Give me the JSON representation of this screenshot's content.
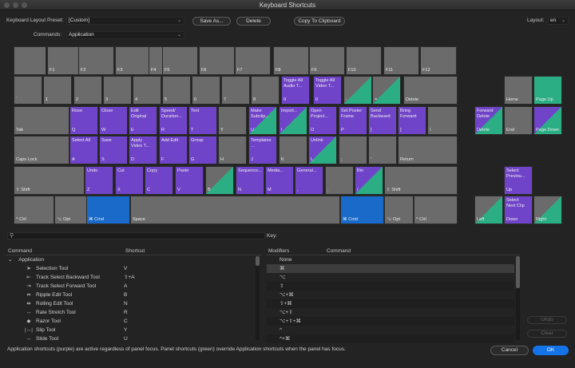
{
  "window": {
    "title": "Keyboard Shortcuts"
  },
  "toolbar": {
    "preset_label": "Keyboard Layout Preset:",
    "preset_value": "[Custom]",
    "commands_label": "Commands:",
    "commands_value": "Application",
    "save_as": "Save As...",
    "delete": "Delete",
    "copy": "Copy To Clipboard",
    "layout_label": "Layout:",
    "layout_value": "en"
  },
  "colors": {
    "application": "#7044c8",
    "panel": "#2cae85",
    "modifier": "#1a6bc9"
  },
  "keyboard": {
    "keys": [
      {
        "label": "",
        "cmd": ""
      },
      {
        "label": "F1",
        "cmd": ""
      },
      {
        "label": "F2",
        "cmd": ""
      },
      {
        "label": "F3",
        "cmd": ""
      },
      {
        "label": "F4",
        "cmd": ""
      },
      {
        "label": "F5",
        "cmd": ""
      },
      {
        "label": "F6",
        "cmd": ""
      },
      {
        "label": "F7",
        "cmd": ""
      },
      {
        "label": "F8",
        "cmd": ""
      },
      {
        "label": "F9",
        "cmd": ""
      },
      {
        "label": "F10",
        "cmd": ""
      },
      {
        "label": "F11",
        "cmd": ""
      },
      {
        "label": "F12",
        "cmd": ""
      },
      {
        "label": "`",
        "cmd": ""
      },
      {
        "label": "1",
        "cmd": ""
      },
      {
        "label": "2",
        "cmd": ""
      },
      {
        "label": "3",
        "cmd": ""
      },
      {
        "label": "4",
        "cmd": ""
      },
      {
        "label": "5",
        "cmd": ""
      },
      {
        "label": "6",
        "cmd": ""
      },
      {
        "label": "7",
        "cmd": ""
      },
      {
        "label": "8",
        "cmd": ""
      },
      {
        "label": "9",
        "cmd": "Toggle All\nAudio T..."
      },
      {
        "label": "0",
        "cmd": "Toggle All\nVideo T..."
      },
      {
        "label": "-",
        "cmd": ""
      },
      {
        "label": "=",
        "cmd": ""
      },
      {
        "label": "Delete",
        "cmd": ""
      },
      {
        "label": "Tab",
        "cmd": ""
      },
      {
        "label": "Q",
        "cmd": "Rose"
      },
      {
        "label": "W",
        "cmd": "Close"
      },
      {
        "label": "E",
        "cmd": "Edit\nOriginal"
      },
      {
        "label": "R",
        "cmd": "Speed/\nDuration..."
      },
      {
        "label": "T",
        "cmd": "Text"
      },
      {
        "label": "Y",
        "cmd": ""
      },
      {
        "label": "U",
        "cmd": "Make\nSubclip..."
      },
      {
        "label": "I",
        "cmd": "Import..."
      },
      {
        "label": "O",
        "cmd": "Open\nProject..."
      },
      {
        "label": "P",
        "cmd": "Set Poster\nFrame"
      },
      {
        "label": "[",
        "cmd": "Send\nBackward"
      },
      {
        "label": "]",
        "cmd": "Bring\nForward"
      },
      {
        "label": "\\",
        "cmd": ""
      },
      {
        "label": "Caps Lock",
        "cmd": ""
      },
      {
        "label": "A",
        "cmd": "Select All"
      },
      {
        "label": "S",
        "cmd": "Save"
      },
      {
        "label": "D",
        "cmd": "Apply\nVideo T..."
      },
      {
        "label": "F",
        "cmd": "Add Edit"
      },
      {
        "label": "G",
        "cmd": "Group"
      },
      {
        "label": "H",
        "cmd": ""
      },
      {
        "label": "J",
        "cmd": "Templates\n..."
      },
      {
        "label": "K",
        "cmd": ""
      },
      {
        "label": "L",
        "cmd": "Unlink"
      },
      {
        "label": ";",
        "cmd": ""
      },
      {
        "label": "'",
        "cmd": ""
      },
      {
        "label": "Return",
        "cmd": ""
      },
      {
        "label": "⇧ Shift",
        "cmd": ""
      },
      {
        "label": "Z",
        "cmd": "Undo"
      },
      {
        "label": "X",
        "cmd": "Cut"
      },
      {
        "label": "C",
        "cmd": "Copy"
      },
      {
        "label": "V",
        "cmd": "Paste"
      },
      {
        "label": "B",
        "cmd": ""
      },
      {
        "label": "N",
        "cmd": "Sequence..."
      },
      {
        "label": "M",
        "cmd": "Media..."
      },
      {
        "label": ",",
        "cmd": "General..."
      },
      {
        "label": ".",
        "cmd": ""
      },
      {
        "label": "/",
        "cmd": "Bin"
      },
      {
        "label": "⇧ Shift",
        "cmd": ""
      },
      {
        "label": "^ Ctrl",
        "cmd": ""
      },
      {
        "label": "⌥ Opt",
        "cmd": ""
      },
      {
        "label": "⌘ Cmd",
        "cmd": ""
      },
      {
        "label": "Space",
        "cmd": ""
      },
      {
        "label": "⌘ Cmd",
        "cmd": ""
      },
      {
        "label": "⌥ Opt",
        "cmd": ""
      },
      {
        "label": "^ Ctrl",
        "cmd": ""
      },
      {
        "label": "Home",
        "cmd": ""
      },
      {
        "label": "Page Up",
        "cmd": ""
      },
      {
        "label": "Delete",
        "cmd": "Forward\nDelete"
      },
      {
        "label": "End",
        "cmd": ""
      },
      {
        "label": "Page\nDown",
        "cmd": ""
      },
      {
        "label": "Up",
        "cmd": "Select\nPreviou..."
      },
      {
        "label": "Left",
        "cmd": ""
      },
      {
        "label": "Down",
        "cmd": "Select\nNext Clip"
      },
      {
        "label": "Right",
        "cmd": ""
      }
    ]
  },
  "list": {
    "col_command": "Command",
    "col_shortcut": "Shortcut",
    "group": "Application",
    "rows": [
      {
        "icon": "selection-tool-icon",
        "glyph": "➤",
        "name": "Selection Tool",
        "shortcut": "V"
      },
      {
        "icon": "track-select-backward-icon",
        "glyph": "⇤",
        "name": "Track Select Backward Tool",
        "shortcut": "⇧+A"
      },
      {
        "icon": "track-select-forward-icon",
        "glyph": "⇥",
        "name": "Track Select Forward Tool",
        "shortcut": "A"
      },
      {
        "icon": "ripple-edit-icon",
        "glyph": "⇹",
        "name": "Ripple Edit Tool",
        "shortcut": "B"
      },
      {
        "icon": "rolling-edit-icon",
        "glyph": "⇼",
        "name": "Rolling Edit Tool",
        "shortcut": "N"
      },
      {
        "icon": "rate-stretch-icon",
        "glyph": "↔",
        "name": "Rate Stretch Tool",
        "shortcut": "R"
      },
      {
        "icon": "razor-icon",
        "glyph": "◆",
        "name": "Razor Tool",
        "shortcut": "C"
      },
      {
        "icon": "slip-icon",
        "glyph": "|↔|",
        "name": "Slip Tool",
        "shortcut": "Y"
      },
      {
        "icon": "slide-icon",
        "glyph": "↔",
        "name": "Slide Tool",
        "shortcut": "U"
      }
    ]
  },
  "key_panel": {
    "title": "Key:",
    "col_modifiers": "Modifiers",
    "col_command": "Command",
    "rows": [
      "None",
      "⌘",
      "⌥",
      "⇧",
      "⌥+⌘",
      "⇧+⌘",
      "⌥+⇧",
      "⌥+⇧+⌘",
      "^",
      "^+⌘"
    ],
    "undo": "Undo",
    "clear": "Clear"
  },
  "footer": {
    "note": "Application shortcuts (purple) are active regardless of panel focus. Panel shortcuts (green) override Application shortcuts when the panel has focus.",
    "cancel": "Cancel",
    "ok": "OK"
  }
}
